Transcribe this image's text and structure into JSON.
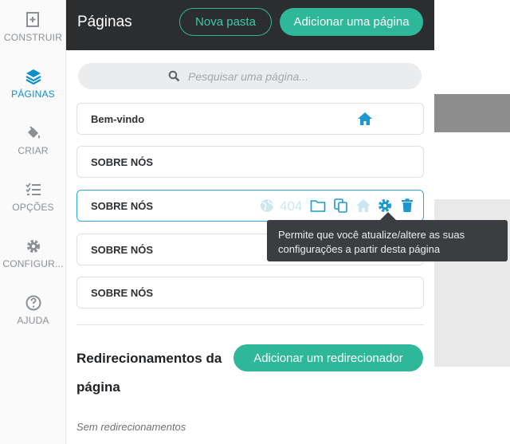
{
  "sidebar": {
    "items": [
      {
        "label": "CONSTRUIR",
        "icon": "add-page-icon",
        "active": false
      },
      {
        "label": "PÁGINAS",
        "icon": "layers-icon",
        "active": true
      },
      {
        "label": "CRIAR",
        "icon": "paint-bucket-icon",
        "active": false
      },
      {
        "label": "OPÇÕES",
        "icon": "checklist-icon",
        "active": false
      },
      {
        "label": "CONFIGUR...",
        "icon": "gear-icon",
        "active": false
      },
      {
        "label": "AJUDA",
        "icon": "help-circle-icon",
        "active": false
      }
    ]
  },
  "panel": {
    "title": "Páginas",
    "new_folder_label": "Nova pasta",
    "add_page_label": "Adicionar uma página"
  },
  "search": {
    "placeholder": "Pesquisar uma página..."
  },
  "pages": [
    {
      "name": "Bem-vindo",
      "is_home": true
    },
    {
      "name": "SOBRE NÓS"
    },
    {
      "name": "SOBRE NÓS",
      "selected": true,
      "badge": "404"
    },
    {
      "name": "SOBRE NÓS"
    },
    {
      "name": "SOBRE NÓS"
    }
  ],
  "tooltip": {
    "text": "Permite que você atualize/altere as suas configurações a partir desta página"
  },
  "redirects": {
    "title": "Redirecionamentos da página",
    "add_label": "Adicionar um redirecionador",
    "empty": "Sem redirecionamentos"
  },
  "colors": {
    "accent": "#2fb79a",
    "active_nav": "#0f8fc7",
    "header_bg": "#2b2d2f",
    "icon_blue": "#1e97cf"
  }
}
